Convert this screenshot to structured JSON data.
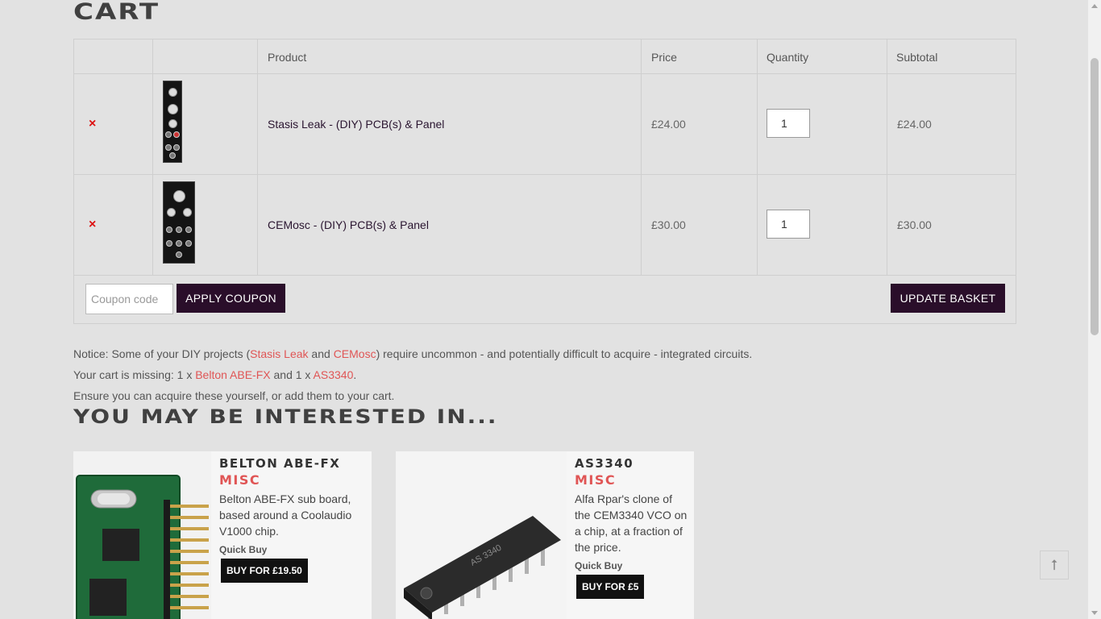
{
  "page_title": "CART",
  "table": {
    "headers": [
      "",
      "",
      "Product",
      "Price",
      "Quantity",
      "Subtotal"
    ],
    "rows": [
      {
        "remove": "×",
        "product": "Stasis Leak - (DIY) PCB(s) & Panel",
        "price": "£24.00",
        "quantity": "1",
        "subtotal": "£24.00"
      },
      {
        "remove": "×",
        "product": "CEMosc - (DIY) PCB(s) & Panel",
        "price": "£30.00",
        "quantity": "1",
        "subtotal": "£30.00"
      }
    ],
    "coupon_placeholder": "Coupon code",
    "apply_coupon": "APPLY COUPON",
    "update_basket": "UPDATE BASKET"
  },
  "notice": {
    "line1_a": "Notice: Some of your DIY projects (",
    "line1_link1": "Stasis Leak",
    "line1_b": " and ",
    "line1_link2": "CEMosc",
    "line1_c": ") require uncommon - and potentially difficult to acquire - integrated circuits.",
    "line2_a": "Your cart is missing: 1 x ",
    "line2_link1": "Belton ABE-FX",
    "line2_b": " and 1 x ",
    "line2_link2": "AS3340",
    "line2_c": ".",
    "line3": "Ensure you can acquire these yourself, or add them to your cart."
  },
  "related": {
    "title": "YOU MAY BE INTERESTED IN...",
    "items": [
      {
        "title": "Belton ABE-FX",
        "category": "MISC",
        "description": "Belton ABE-FX sub board, based around a Coolaudio V1000 chip.",
        "quick_buy": "Quick Buy",
        "buy": "BUY FOR £19.50"
      },
      {
        "title": "AS3340",
        "category": "MISC",
        "description": "Alfa Rpar's clone of the CEM3340 VCO on a chip, at a fraction of the price.",
        "quick_buy": "Quick Buy",
        "buy": "BUY FOR £5"
      }
    ]
  },
  "back_to_top": "⭡",
  "colors": {
    "accent": "#e05555",
    "button": "#2a0e2a",
    "remove": "#dd1111",
    "background": "#e2e2e2"
  },
  "icons": {
    "remove": "close-icon",
    "back_to_top": "arrow-up-icon"
  }
}
